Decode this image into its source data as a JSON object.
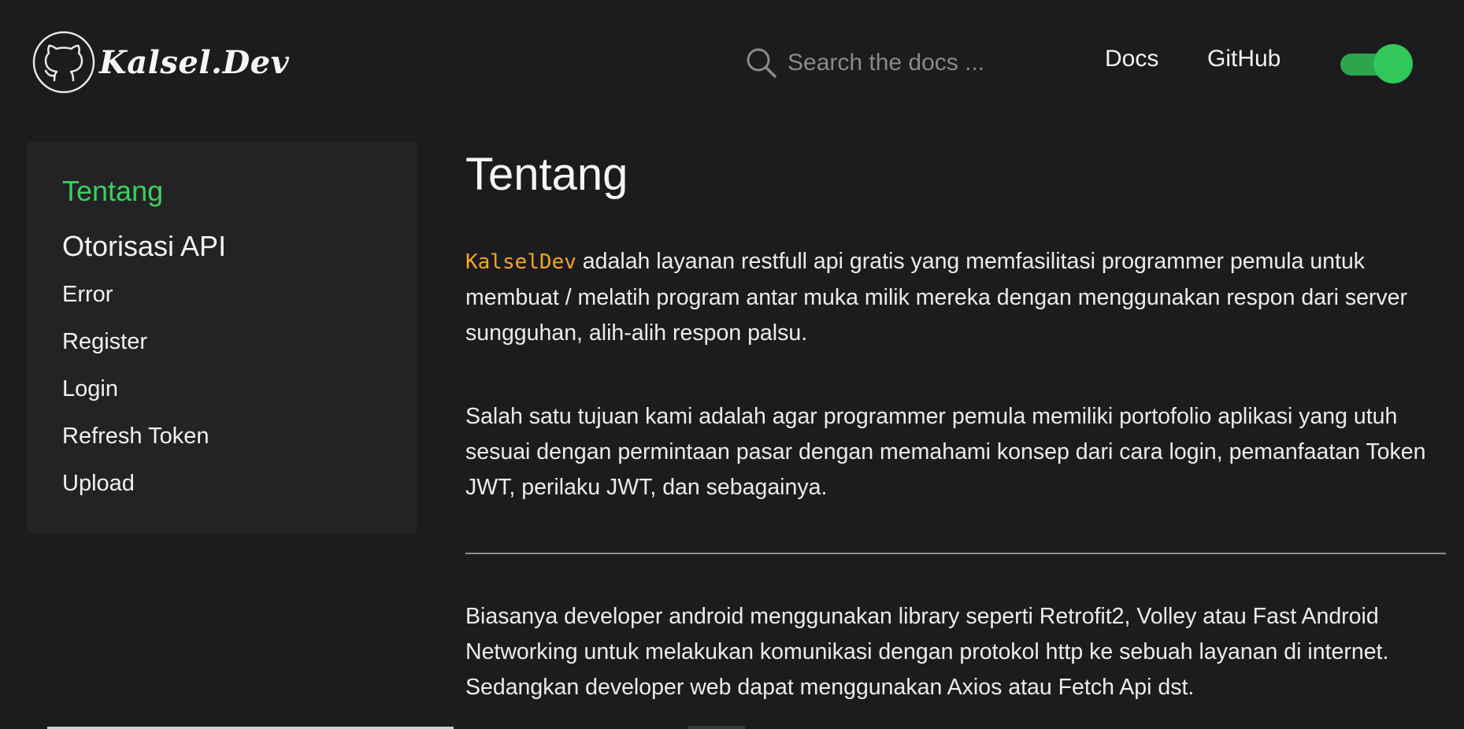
{
  "header": {
    "logo_text": "Kalsel.Dev",
    "logo_icon": "github-cat-icon",
    "search": {
      "placeholder": "Search the docs ...",
      "value": "",
      "icon": "search-icon"
    },
    "nav": [
      {
        "label": "Docs"
      },
      {
        "label": "GitHub"
      }
    ],
    "theme_toggle": {
      "on": true,
      "color": "#31c75a"
    }
  },
  "sidebar": {
    "active_item": "Tentang",
    "section_title": "Otorisasi API",
    "items": [
      {
        "label": "Error"
      },
      {
        "label": "Register"
      },
      {
        "label": "Login"
      },
      {
        "label": "Refresh Token"
      },
      {
        "label": "Upload"
      }
    ]
  },
  "main": {
    "title": "Tentang",
    "para1": {
      "code": "KalselDev",
      "text": " adalah layanan restfull api gratis yang memfasilitasi programmer pemula untuk membuat / melatih program antar muka milik mereka dengan menggunakan respon dari server sungguhan, alih-alih respon palsu."
    },
    "para2": "Salah satu tujuan kami adalah agar programmer pemula memiliki portofolio aplikasi yang utuh sesuai dengan permintaan pasar dengan memahami konsep dari cara login, pemanfaatan Token JWT, perilaku JWT, dan sebagainya.",
    "para3": "Biasanya developer android menggunakan library seperti Retrofit2, Volley atau Fast Android Networking untuk melakukan komunikasi dengan protokol http ke sebuah layanan di internet. Sedangkan developer web dapat menggunakan Axios atau Fetch Api dst."
  },
  "colors": {
    "background": "#1c1c1e",
    "sidebar_bg": "#232325",
    "accent_green": "#3ccf5e",
    "code_orange": "#f5a623"
  }
}
